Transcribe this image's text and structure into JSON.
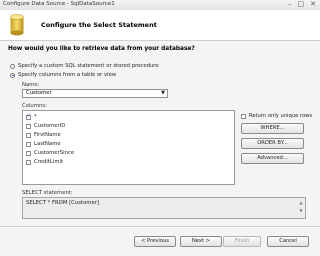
{
  "window": {
    "title": "Configure Data Source - SqlDataSource1",
    "controls": [
      "–",
      "□",
      "✕"
    ]
  },
  "header": {
    "title": "Configure the Select Statement",
    "icon": "database-icon"
  },
  "question": "How would you like to retrieve data from your database?",
  "options": {
    "custom_sql": "Specify a custom SQL statement or stored procedure",
    "columns": "Specify columns from a table or view",
    "selected": "columns"
  },
  "name_field": {
    "label": "Name:",
    "value": "Customer"
  },
  "columns_label": "Columns:",
  "columns": [
    {
      "label": "*",
      "checked": true
    },
    {
      "label": "CustomerID",
      "checked": false
    },
    {
      "label": "FirstName",
      "checked": false
    },
    {
      "label": "LastName",
      "checked": false
    },
    {
      "label": "CustomerSince",
      "checked": false
    },
    {
      "label": "CreditLimit",
      "checked": false
    }
  ],
  "unique_rows_label": "Return only unique rows",
  "side_buttons": {
    "where": "WHERE...",
    "order_by": "ORDER BY...",
    "advanced": "Advanced..."
  },
  "select_statement": {
    "label": "SELECT statement:",
    "value": "SELECT * FROM [Customer]"
  },
  "footer": {
    "previous": "< Previous",
    "next": "Next >",
    "finish": "Finish",
    "cancel": "Cancel"
  }
}
